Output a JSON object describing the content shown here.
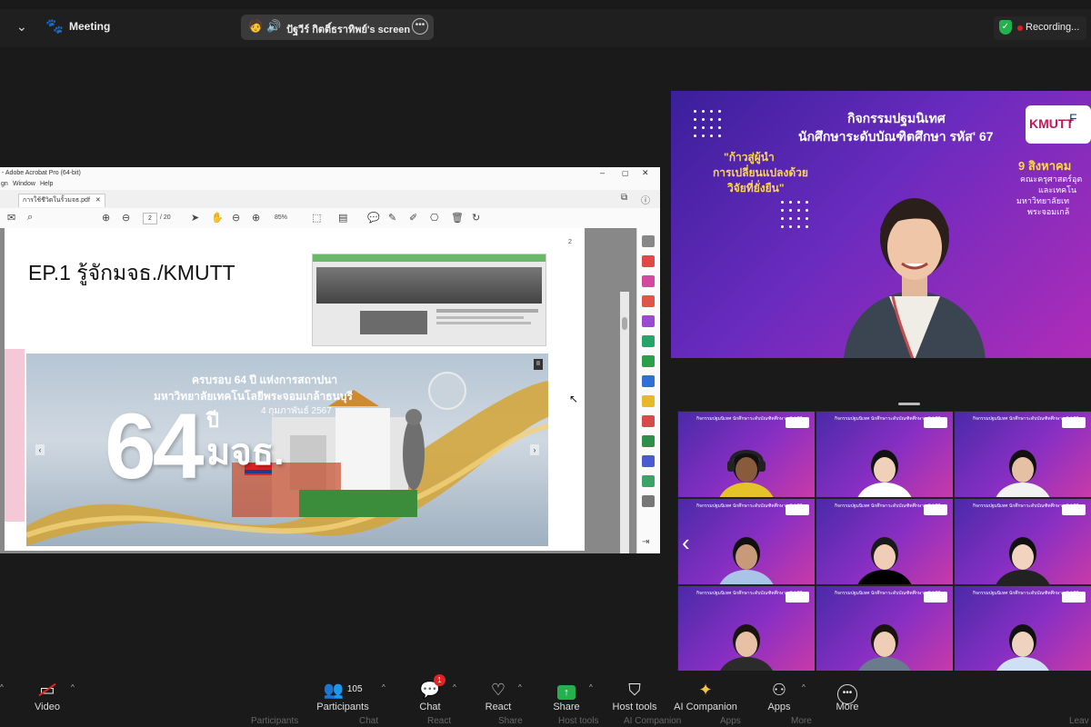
{
  "topbar": {
    "meeting_label": "Meeting",
    "share_label": "ปัฐวีร์ กิตติ์ธราทิพย์'s screen",
    "recording_label": "Recording..."
  },
  "acrobat": {
    "window_title": "- Adobe Acrobat Pro (64-bit)",
    "menus": [
      "gn",
      "Window",
      "Help"
    ],
    "tab_label": "การใช้ชีวิตในรั้วมจธ.pdf",
    "page_current": "2",
    "page_total": "/ 20",
    "zoom": "85%",
    "page_number_right": "2"
  },
  "slide": {
    "title": "EP.1 รู้จักมจธ./KMUTT",
    "banner_line1": "ครบรอบ 64 ปี แห่งการสถาปนา",
    "banner_line2": "มหาวิทยาลัยเทคโนโลยีพระจอมเกล้าธนบุรี",
    "banner_line3": "4 กุมภาพันธ์ 2567",
    "banner_big": "64",
    "banner_pi": "ปี",
    "banner_mjc": "มจธ."
  },
  "speaker_tile": {
    "heading1": "กิจกรรมปฐมนิเทศ",
    "heading2": "นักศึกษาระดับบัณฑิตศึกษา รหัส' 67",
    "quote1": "\"ก้าวสู่ผู้นำ",
    "quote2": "การเปลี่ยนแปลงด้วย",
    "quote3": "วิจัยที่ยั่งยืน\"",
    "date": "9 สิงหาคม",
    "faculty1": "คณะครุศาสตร์อุต",
    "faculty2": "และเทคโน",
    "faculty3": "มหาวิทยาลัยเท",
    "faculty4": "พระจอมเกล้",
    "logo_text": "KMUTT",
    "logo_text2": "F"
  },
  "gallery": {
    "tile_heading": "กิจกรรมปฐมนิเทศ นักศึกษาระดับบัณฑิตศึกษา รหัส' 67",
    "tile_count": 9
  },
  "toolbar": {
    "items": [
      {
        "label": "Video",
        "icon": "video-off-icon"
      },
      {
        "label": "Participants",
        "icon": "participants-icon",
        "count": "105"
      },
      {
        "label": "Chat",
        "icon": "chat-icon",
        "badge": "1"
      },
      {
        "label": "React",
        "icon": "heart-icon"
      },
      {
        "label": "Share",
        "icon": "share-icon"
      },
      {
        "label": "Host tools",
        "icon": "shield-icon"
      },
      {
        "label": "AI Companion",
        "icon": "sparkle-icon"
      },
      {
        "label": "Apps",
        "icon": "apps-icon"
      },
      {
        "label": "More",
        "icon": "more-icon"
      }
    ]
  },
  "ghost_labels": [
    "Participants",
    "Chat",
    "React",
    "Share",
    "Host tools",
    "AI Companion",
    "Apps",
    "More",
    "Leav"
  ],
  "colors": {
    "recording_shield": "#23b14d",
    "share_green": "#22b14c",
    "chat_badge": "#e02424",
    "tile_purple": "#6a2bbf"
  }
}
